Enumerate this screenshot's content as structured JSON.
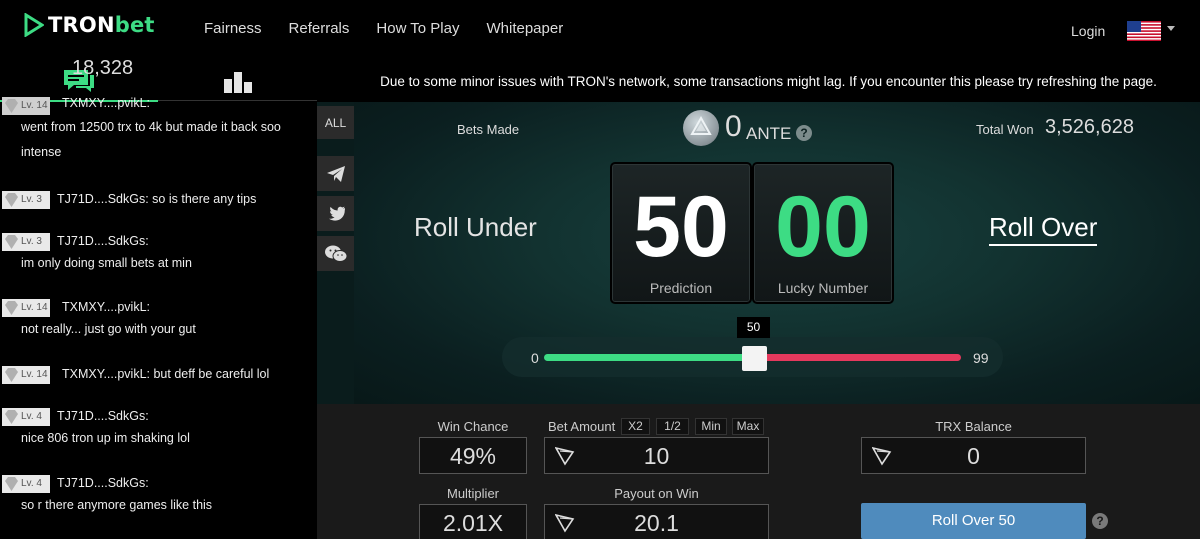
{
  "header": {
    "brand_part1": "TRON",
    "brand_part2": "bet",
    "nav": [
      "Fairness",
      "Referrals",
      "How To Play",
      "Whitepaper"
    ],
    "login_label": "Login",
    "language_flag": "us-flag-icon"
  },
  "sidebar": {
    "tabs": [
      "chat-icon",
      "leaderboard-icon"
    ],
    "messages": [
      {
        "level": "Lv. 14",
        "user": "TXMXY....pvikL:",
        "text": "went from 12500 trx to 4k but made it back soo"
      },
      {
        "level": "",
        "user": "",
        "text": "intense"
      },
      {
        "level": "Lv. 3",
        "user": "TJ71D....SdkGs: so is there any tips",
        "text": ""
      },
      {
        "level": "Lv. 3",
        "user": "TJ71D....SdkGs:",
        "text": "im only doing small bets at min"
      },
      {
        "level": "Lv. 14",
        "user": "TXMXY....pvikL:",
        "text": "not really... just go with your gut"
      },
      {
        "level": "Lv. 14",
        "user": "TXMXY....pvikL: but deff be careful lol",
        "text": ""
      },
      {
        "level": "Lv. 4",
        "user": "TJ71D....SdkGs:",
        "text": "nice 806 tron up im shaking lol"
      },
      {
        "level": "Lv. 4",
        "user": "TJ71D....SdkGs:",
        "text": "so r there anymore games like this"
      }
    ]
  },
  "side_icons": {
    "all_label": "ALL",
    "icons": [
      "telegram-icon",
      "twitter-icon",
      "wechat-icon"
    ]
  },
  "notice": "Due to some minor issues with TRON's network, some transactions might lag. If you encounter this please try refreshing the page.",
  "stats": {
    "bets_made_value": "18,328",
    "bets_made_label": "Bets Made",
    "ante_value": "0",
    "ante_label": "ANTE",
    "total_won_label": "Total Won",
    "total_won_value": "3,526,628"
  },
  "game": {
    "roll_under_label": "Roll Under",
    "roll_over_label": "Roll Over",
    "prediction_value": "50",
    "prediction_label": "Prediction",
    "lucky_value": "00",
    "lucky_label": "Lucky Number",
    "slider": {
      "min": "0",
      "max": "99",
      "value": "50",
      "fraction": 0.5
    }
  },
  "bet_panel": {
    "win_chance_label": "Win Chance",
    "win_chance_value": "49%",
    "bet_amount_label": "Bet Amount",
    "bet_amount_value": "10",
    "quick_buttons": [
      "X2",
      "1/2",
      "Min",
      "Max"
    ],
    "trx_balance_label": "TRX Balance",
    "trx_balance_value": "0",
    "multiplier_label": "Multiplier",
    "multiplier_value": "2.01X",
    "payout_label": "Payout on Win",
    "payout_value": "20.1",
    "roll_button_label": "Roll Over 50"
  },
  "colors": {
    "accent_green": "#3ddc84",
    "accent_red": "#e5395d",
    "roll_button": "#4f8bbd"
  }
}
